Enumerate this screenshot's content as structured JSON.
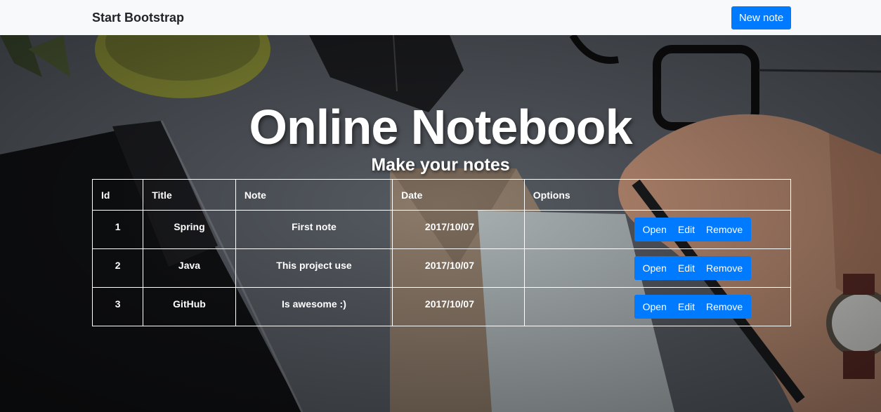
{
  "navbar": {
    "brand": "Start Bootstrap",
    "new_note_label": "New note"
  },
  "hero": {
    "title": "Online Notebook",
    "subtitle": "Make your notes"
  },
  "table": {
    "headers": [
      "Id",
      "Title",
      "Note",
      "Date",
      "Options"
    ],
    "rows": [
      {
        "id": "1",
        "title": "Spring",
        "note": "First note",
        "date": "2017/10/07"
      },
      {
        "id": "2",
        "title": "Java",
        "note": "This project use",
        "date": "2017/10/07"
      },
      {
        "id": "3",
        "title": "GitHub",
        "note": "Is awesome :)",
        "date": "2017/10/07"
      }
    ],
    "actions": {
      "open": "Open",
      "edit": "Edit",
      "remove": "Remove"
    }
  },
  "colors": {
    "primary": "#007bff",
    "navbar_bg": "#f8f9fa",
    "text_light": "#ffffff"
  }
}
